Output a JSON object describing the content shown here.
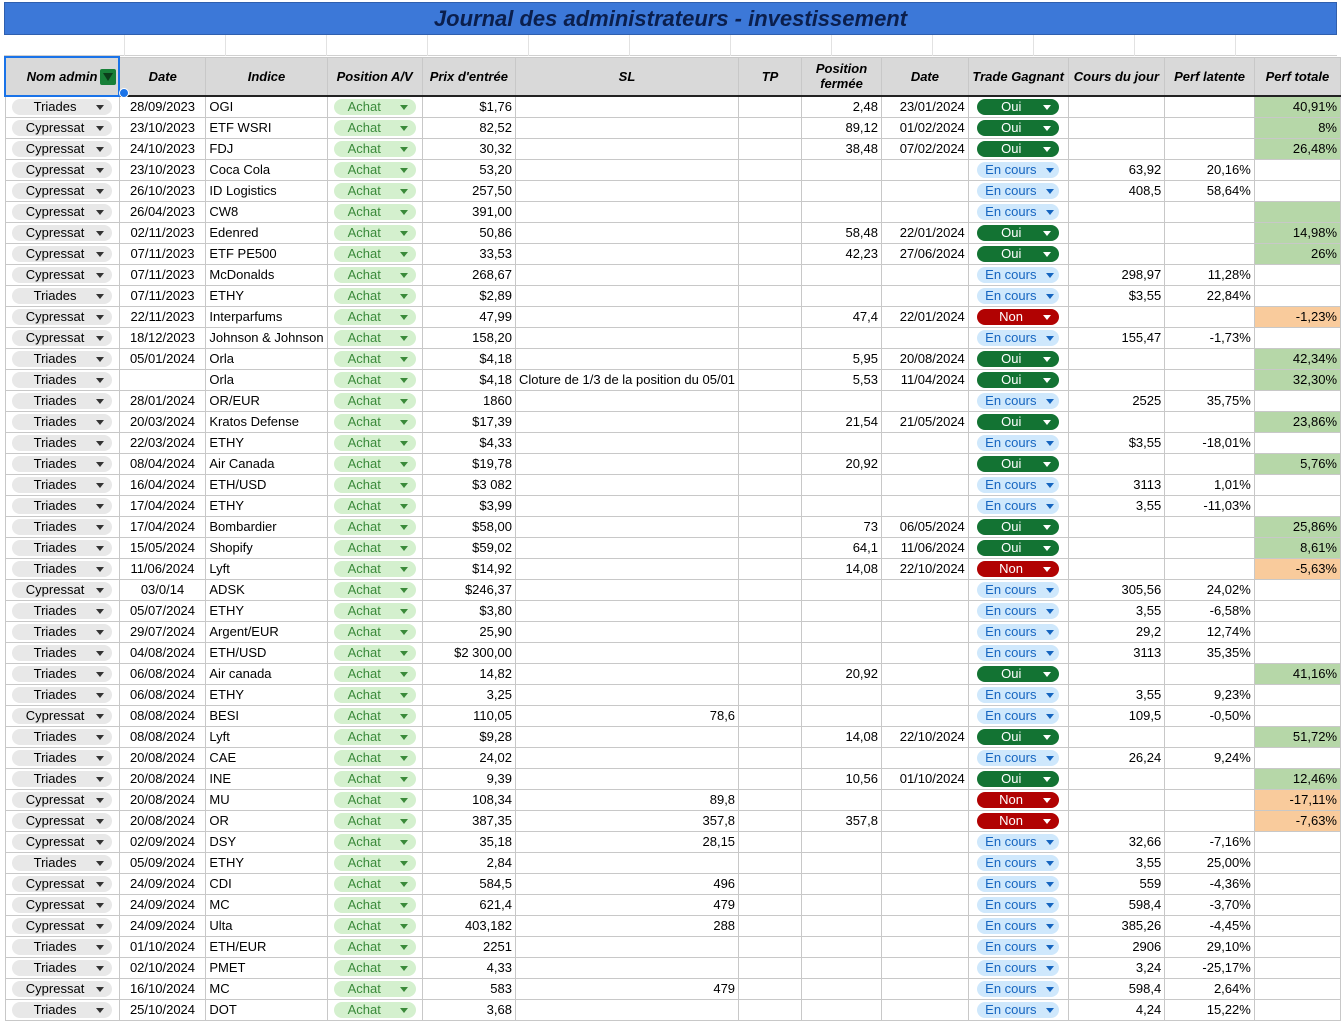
{
  "title": "Journal des administrateurs - investissement",
  "headers": {
    "admin": "Nom admin",
    "date": "Date",
    "indice": "Indice",
    "position": "Position A/V",
    "prix": "Prix d'entrée",
    "sl": "SL",
    "tp": "TP",
    "position_fermee": "Position fermée",
    "date_fermeture": "Date",
    "gagnant": "Trade Gagnant",
    "cours": "Cours du jour",
    "perf_latente": "Perf latente",
    "perf_totale": "Perf totale"
  },
  "icons": {
    "filter": "filter-icon",
    "dropdown": "chevron-down-icon"
  },
  "colors": {
    "title_bg": "#3c78d8",
    "win_bg": "#b6d7a8",
    "loss_bg": "#f9cb9c",
    "oui_chip": "#137333",
    "non_chip": "#b10202",
    "encours_chip": "#cfe8fc",
    "achat_chip": "#d4f0ce"
  },
  "rows": [
    {
      "admin": "Triades",
      "date": "28/09/2023",
      "indice": "OGI",
      "position": "Achat",
      "prix": "$1,76",
      "sl": "",
      "tp": "",
      "closed": "2,48",
      "date2": "23/01/2024",
      "gagnant": "Oui",
      "cours": "",
      "latente": "",
      "totale": "40,91%"
    },
    {
      "admin": "Cypressat",
      "date": "23/10/2023",
      "indice": "ETF WSRI",
      "position": "Achat",
      "prix": "82,52",
      "sl": "",
      "tp": "",
      "closed": "89,12",
      "date2": "01/02/2024",
      "gagnant": "Oui",
      "cours": "",
      "latente": "",
      "totale": "8%"
    },
    {
      "admin": "Cypressat",
      "date": "24/10/2023",
      "indice": "FDJ",
      "position": "Achat",
      "prix": "30,32",
      "sl": "",
      "tp": "",
      "closed": "38,48",
      "date2": "07/02/2024",
      "gagnant": "Oui",
      "cours": "",
      "latente": "",
      "totale": "26,48%"
    },
    {
      "admin": "Cypressat",
      "date": "23/10/2023",
      "indice": "Coca Cola",
      "position": "Achat",
      "prix": "53,20",
      "sl": "",
      "tp": "",
      "closed": "",
      "date2": "",
      "gagnant": "En cours",
      "cours": "63,92",
      "latente": "20,16%",
      "totale": ""
    },
    {
      "admin": "Cypressat",
      "date": "26/10/2023",
      "indice": "ID Logistics",
      "position": "Achat",
      "prix": "257,50",
      "sl": "",
      "tp": "",
      "closed": "",
      "date2": "",
      "gagnant": "En cours",
      "cours": "408,5",
      "latente": "58,64%",
      "totale": ""
    },
    {
      "admin": "Cypressat",
      "date": "26/04/2023",
      "indice": "CW8",
      "position": "Achat",
      "prix": "391,00",
      "sl": "",
      "tp": "",
      "closed": "",
      "date2": "",
      "gagnant": "En cours",
      "cours": "",
      "latente": "",
      "totale": "",
      "winbg": true
    },
    {
      "admin": "Cypressat",
      "date": "02/11/2023",
      "indice": "Edenred",
      "position": "Achat",
      "prix": "50,86",
      "sl": "",
      "tp": "",
      "closed": "58,48",
      "date2": "22/01/2024",
      "gagnant": "Oui",
      "cours": "",
      "latente": "",
      "totale": "14,98%"
    },
    {
      "admin": "Cypressat",
      "date": "07/11/2023",
      "indice": "ETF PE500",
      "position": "Achat",
      "prix": "33,53",
      "sl": "",
      "tp": "",
      "closed": "42,23",
      "date2": "27/06/2024",
      "gagnant": "Oui",
      "cours": "",
      "latente": "",
      "totale": "26%"
    },
    {
      "admin": "Cypressat",
      "date": "07/11/2023",
      "indice": "McDonalds",
      "position": "Achat",
      "prix": "268,67",
      "sl": "",
      "tp": "",
      "closed": "",
      "date2": "",
      "gagnant": "En cours",
      "cours": "298,97",
      "latente": "11,28%",
      "totale": ""
    },
    {
      "admin": "Triades",
      "date": "07/11/2023",
      "indice": "ETHY",
      "position": "Achat",
      "prix": "$2,89",
      "sl": "",
      "tp": "",
      "closed": "",
      "date2": "",
      "gagnant": "En cours",
      "cours": "$3,55",
      "latente": "22,84%",
      "totale": ""
    },
    {
      "admin": "Cypressat",
      "date": "22/11/2023",
      "indice": "Interparfums",
      "position": "Achat",
      "prix": "47,99",
      "sl": "",
      "tp": "",
      "closed": "47,4",
      "date2": "22/01/2024",
      "gagnant": "Non",
      "cours": "",
      "latente": "",
      "totale": "-1,23%"
    },
    {
      "admin": "Cypressat",
      "date": "18/12/2023",
      "indice": "Johnson & Johnson",
      "position": "Achat",
      "prix": "158,20",
      "sl": "",
      "tp": "",
      "closed": "",
      "date2": "",
      "gagnant": "En cours",
      "cours": "155,47",
      "latente": "-1,73%",
      "totale": ""
    },
    {
      "admin": "Triades",
      "date": "05/01/2024",
      "indice": "Orla",
      "position": "Achat",
      "prix": "$4,18",
      "sl": "",
      "tp": "",
      "closed": "5,95",
      "date2": "20/08/2024",
      "gagnant": "Oui",
      "cours": "",
      "latente": "",
      "totale": "42,34%"
    },
    {
      "admin": "Triades",
      "date": "",
      "indice": "Orla",
      "position": "Achat",
      "prix": "$4,18",
      "sl": "Cloture de 1/3 de la position du 05/01",
      "tp": "",
      "closed": "5,53",
      "date2": "11/04/2024",
      "gagnant": "Oui",
      "cours": "",
      "latente": "",
      "totale": "32,30%",
      "note": true
    },
    {
      "admin": "Triades",
      "date": "28/01/2024",
      "indice": "OR/EUR",
      "position": "Achat",
      "prix": "1860",
      "sl": "",
      "tp": "",
      "closed": "",
      "date2": "",
      "gagnant": "En cours",
      "cours": "2525",
      "latente": "35,75%",
      "totale": ""
    },
    {
      "admin": "Triades",
      "date": "20/03/2024",
      "indice": "Kratos Defense",
      "position": "Achat",
      "prix": "$17,39",
      "sl": "",
      "tp": "",
      "closed": "21,54",
      "date2": "21/05/2024",
      "gagnant": "Oui",
      "cours": "",
      "latente": "",
      "totale": "23,86%"
    },
    {
      "admin": "Triades",
      "date": "22/03/2024",
      "indice": "ETHY",
      "position": "Achat",
      "prix": "$4,33",
      "sl": "",
      "tp": "",
      "closed": "",
      "date2": "",
      "gagnant": "En cours",
      "cours": "$3,55",
      "latente": "-18,01%",
      "totale": ""
    },
    {
      "admin": "Triades",
      "date": "08/04/2024",
      "indice": "Air Canada",
      "position": "Achat",
      "prix": "$19,78",
      "sl": "",
      "tp": "",
      "closed": "20,92",
      "date2": "",
      "gagnant": "Oui",
      "cours": "",
      "latente": "",
      "totale": "5,76%"
    },
    {
      "admin": "Triades",
      "date": "16/04/2024",
      "indice": "ETH/USD",
      "position": "Achat",
      "prix": "$3 082",
      "sl": "",
      "tp": "",
      "closed": "",
      "date2": "",
      "gagnant": "En cours",
      "cours": "3113",
      "latente": "1,01%",
      "totale": ""
    },
    {
      "admin": "Triades",
      "date": "17/04/2024",
      "indice": "ETHY",
      "position": "Achat",
      "prix": "$3,99",
      "sl": "",
      "tp": "",
      "closed": "",
      "date2": "",
      "gagnant": "En cours",
      "cours": "3,55",
      "latente": "-11,03%",
      "totale": ""
    },
    {
      "admin": "Triades",
      "date": "17/04/2024",
      "indice": "Bombardier",
      "position": "Achat",
      "prix": "$58,00",
      "sl": "",
      "tp": "",
      "closed": "73",
      "date2": "06/05/2024",
      "gagnant": "Oui",
      "cours": "",
      "latente": "",
      "totale": "25,86%"
    },
    {
      "admin": "Triades",
      "date": "15/05/2024",
      "indice": "Shopify",
      "position": "Achat",
      "prix": "$59,02",
      "sl": "",
      "tp": "",
      "closed": "64,1",
      "date2": "11/06/2024",
      "gagnant": "Oui",
      "cours": "",
      "latente": "",
      "totale": "8,61%"
    },
    {
      "admin": "Triades",
      "date": "11/06/2024",
      "indice": "Lyft",
      "position": "Achat",
      "prix": "$14,92",
      "sl": "",
      "tp": "",
      "closed": "14,08",
      "date2": "22/10/2024",
      "gagnant": "Non",
      "cours": "",
      "latente": "",
      "totale": "-5,63%"
    },
    {
      "admin": "Cypressat",
      "date": "03/0/14",
      "indice": "ADSK",
      "position": "Achat",
      "prix": "$246,37",
      "sl": "",
      "tp": "",
      "closed": "",
      "date2": "",
      "gagnant": "En cours",
      "cours": "305,56",
      "latente": "24,02%",
      "totale": ""
    },
    {
      "admin": "Triades",
      "date": "05/07/2024",
      "indice": "ETHY",
      "position": "Achat",
      "prix": "$3,80",
      "sl": "",
      "tp": "",
      "closed": "",
      "date2": "",
      "gagnant": "En cours",
      "cours": "3,55",
      "latente": "-6,58%",
      "totale": ""
    },
    {
      "admin": "Triades",
      "date": "29/07/2024",
      "indice": "Argent/EUR",
      "position": "Achat",
      "prix": "25,90",
      "sl": "",
      "tp": "",
      "closed": "",
      "date2": "",
      "gagnant": "En cours",
      "cours": "29,2",
      "latente": "12,74%",
      "totale": ""
    },
    {
      "admin": "Triades",
      "date": "04/08/2024",
      "indice": "ETH/USD",
      "position": "Achat",
      "prix": "$2 300,00",
      "sl": "",
      "tp": "",
      "closed": "",
      "date2": "",
      "gagnant": "En cours",
      "cours": "3113",
      "latente": "35,35%",
      "totale": ""
    },
    {
      "admin": "Triades",
      "date": "06/08/2024",
      "indice": "Air canada",
      "position": "Achat",
      "prix": "14,82",
      "sl": "",
      "tp": "",
      "closed": "20,92",
      "date2": "",
      "gagnant": "Oui",
      "cours": "",
      "latente": "",
      "totale": "41,16%"
    },
    {
      "admin": "Triades",
      "date": "06/08/2024",
      "indice": "ETHY",
      "position": "Achat",
      "prix": "3,25",
      "sl": "",
      "tp": "",
      "closed": "",
      "date2": "",
      "gagnant": "En cours",
      "cours": "3,55",
      "latente": "9,23%",
      "totale": ""
    },
    {
      "admin": "Cypressat",
      "date": "08/08/2024",
      "indice": "BESI",
      "position": "Achat",
      "prix": "110,05",
      "sl": "78,6",
      "tp": "",
      "closed": "",
      "date2": "",
      "gagnant": "En cours",
      "cours": "109,5",
      "latente": "-0,50%",
      "totale": ""
    },
    {
      "admin": "Triades",
      "date": "08/08/2024",
      "indice": "Lyft",
      "position": "Achat",
      "prix": "$9,28",
      "sl": "",
      "tp": "",
      "closed": "14,08",
      "date2": "22/10/2024",
      "gagnant": "Oui",
      "cours": "",
      "latente": "",
      "totale": "51,72%"
    },
    {
      "admin": "Triades",
      "date": "20/08/2024",
      "indice": "CAE",
      "position": "Achat",
      "prix": "24,02",
      "sl": "",
      "tp": "",
      "closed": "",
      "date2": "",
      "gagnant": "En cours",
      "cours": "26,24",
      "latente": "9,24%",
      "totale": ""
    },
    {
      "admin": "Triades",
      "date": "20/08/2024",
      "indice": "INE",
      "position": "Achat",
      "prix": "9,39",
      "sl": "",
      "tp": "",
      "closed": "10,56",
      "date2": "01/10/2024",
      "gagnant": "Oui",
      "cours": "",
      "latente": "",
      "totale": "12,46%"
    },
    {
      "admin": "Cypressat",
      "date": "20/08/2024",
      "indice": "MU",
      "position": "Achat",
      "prix": "108,34",
      "sl": "89,8",
      "tp": "",
      "closed": "",
      "date2": "",
      "gagnant": "Non",
      "cours": "",
      "latente": "",
      "totale": "-17,11%"
    },
    {
      "admin": "Cypressat",
      "date": "20/08/2024",
      "indice": "OR",
      "position": "Achat",
      "prix": "387,35",
      "sl": "357,8",
      "tp": "",
      "closed": "357,8",
      "date2": "",
      "gagnant": "Non",
      "cours": "",
      "latente": "",
      "totale": "-7,63%"
    },
    {
      "admin": "Cypressat",
      "date": "02/09/2024",
      "indice": "DSY",
      "position": "Achat",
      "prix": "35,18",
      "sl": "28,15",
      "tp": "",
      "closed": "",
      "date2": "",
      "gagnant": "En cours",
      "cours": "32,66",
      "latente": "-7,16%",
      "totale": ""
    },
    {
      "admin": "Triades",
      "date": "05/09/2024",
      "indice": "ETHY",
      "position": "Achat",
      "prix": "2,84",
      "sl": "",
      "tp": "",
      "closed": "",
      "date2": "",
      "gagnant": "En cours",
      "cours": "3,55",
      "latente": "25,00%",
      "totale": ""
    },
    {
      "admin": "Cypressat",
      "date": "24/09/2024",
      "indice": "CDI",
      "position": "Achat",
      "prix": "584,5",
      "sl": "496",
      "tp": "",
      "closed": "",
      "date2": "",
      "gagnant": "En cours",
      "cours": "559",
      "latente": "-4,36%",
      "totale": ""
    },
    {
      "admin": "Cypressat",
      "date": "24/09/2024",
      "indice": "MC",
      "position": "Achat",
      "prix": "621,4",
      "sl": "479",
      "tp": "",
      "closed": "",
      "date2": "",
      "gagnant": "En cours",
      "cours": "598,4",
      "latente": "-3,70%",
      "totale": ""
    },
    {
      "admin": "Cypressat",
      "date": "24/09/2024",
      "indice": "Ulta",
      "position": "Achat",
      "prix": "403,182",
      "sl": "288",
      "tp": "",
      "closed": "",
      "date2": "",
      "gagnant": "En cours",
      "cours": "385,26",
      "latente": "-4,45%",
      "totale": ""
    },
    {
      "admin": "Triades",
      "date": "01/10/2024",
      "indice": "ETH/EUR",
      "position": "Achat",
      "prix": "2251",
      "sl": "",
      "tp": "",
      "closed": "",
      "date2": "",
      "gagnant": "En cours",
      "cours": "2906",
      "latente": "29,10%",
      "totale": ""
    },
    {
      "admin": "Triades",
      "date": "02/10/2024",
      "indice": "PMET",
      "position": "Achat",
      "prix": "4,33",
      "sl": "",
      "tp": "",
      "closed": "",
      "date2": "",
      "gagnant": "En cours",
      "cours": "3,24",
      "latente": "-25,17%",
      "totale": ""
    },
    {
      "admin": "Cypressat",
      "date": "16/10/2024",
      "indice": "MC",
      "position": "Achat",
      "prix": "583",
      "sl": "479",
      "tp": "",
      "closed": "",
      "date2": "",
      "gagnant": "En cours",
      "cours": "598,4",
      "latente": "2,64%",
      "totale": ""
    },
    {
      "admin": "Triades",
      "date": "25/10/2024",
      "indice": "DOT",
      "position": "Achat",
      "prix": "3,68",
      "sl": "",
      "tp": "",
      "closed": "",
      "date2": "",
      "gagnant": "En cours",
      "cours": "4,24",
      "latente": "15,22%",
      "totale": ""
    }
  ]
}
